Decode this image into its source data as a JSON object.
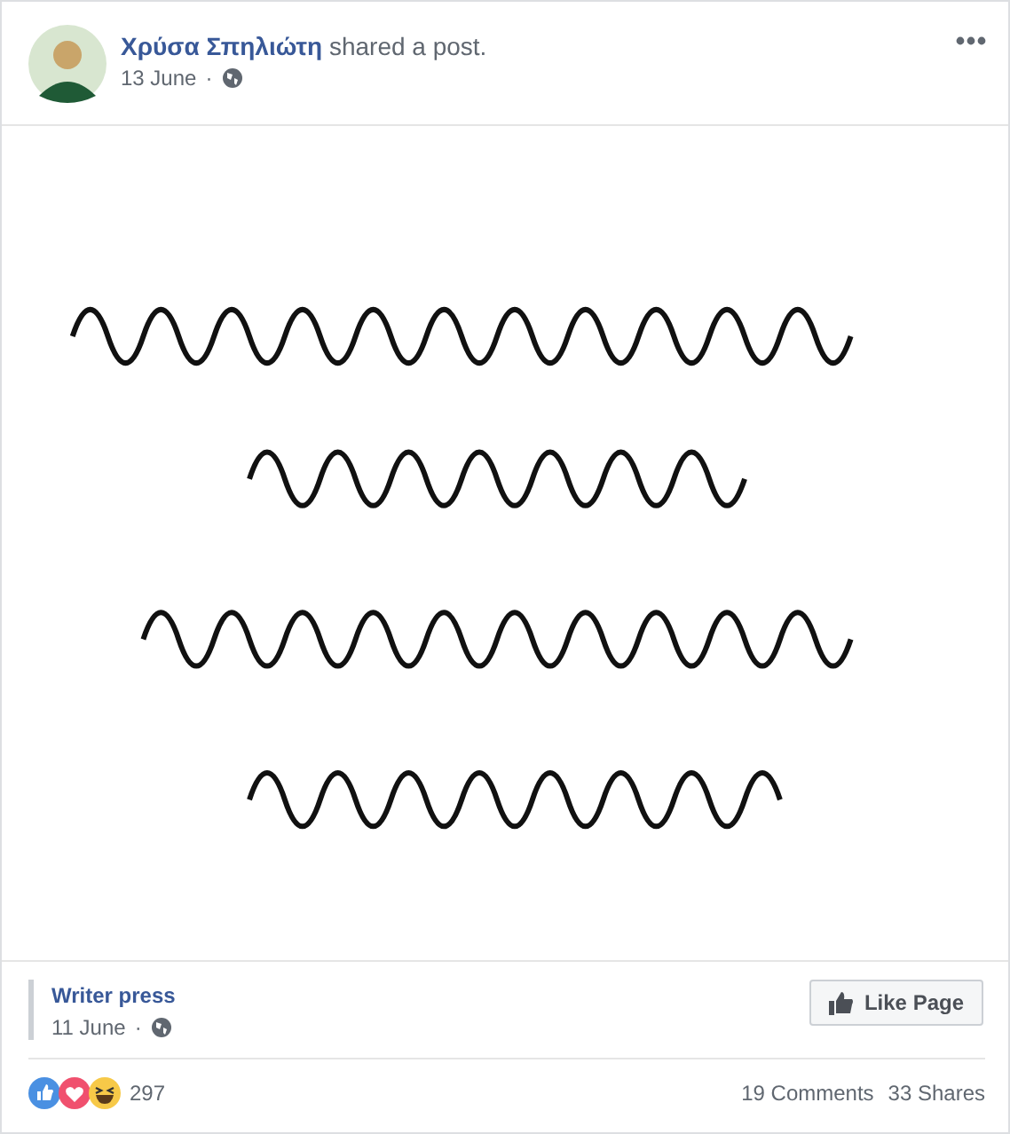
{
  "post": {
    "author": "Χρύσα Σπηλιώτη",
    "action": "shared a post.",
    "date": "13 June",
    "separator": "·"
  },
  "shared": {
    "page": "Writer press",
    "date": "11 June",
    "separator": "·",
    "button": "Like Page"
  },
  "footer": {
    "reaction_count": "297",
    "comments": "19 Comments",
    "shares": "33 Shares"
  }
}
